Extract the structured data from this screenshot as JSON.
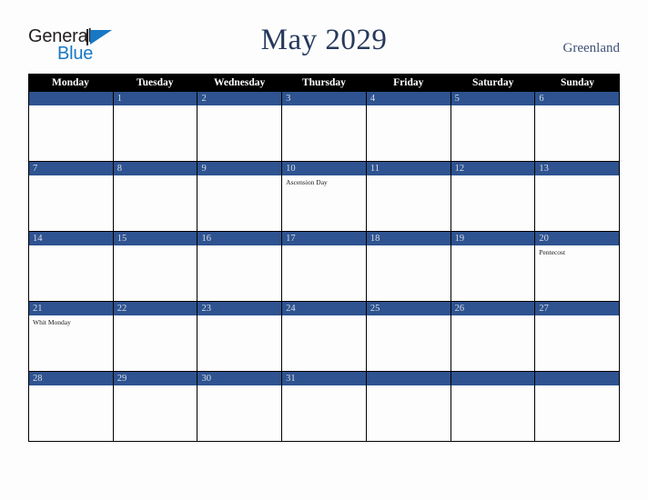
{
  "brand": {
    "line1": "General",
    "line2": "Blue",
    "triangle_color": "#1878c4"
  },
  "header": {
    "title": "May 2029",
    "country": "Greenland",
    "title_color": "#26395c"
  },
  "calendar": {
    "accent_color": "#2e5390",
    "header_bg": "#000000",
    "weekdays": [
      "Monday",
      "Tuesday",
      "Wednesday",
      "Thursday",
      "Friday",
      "Saturday",
      "Sunday"
    ],
    "weeks": [
      [
        {
          "date": "",
          "event": ""
        },
        {
          "date": "1",
          "event": ""
        },
        {
          "date": "2",
          "event": ""
        },
        {
          "date": "3",
          "event": ""
        },
        {
          "date": "4",
          "event": ""
        },
        {
          "date": "5",
          "event": ""
        },
        {
          "date": "6",
          "event": ""
        }
      ],
      [
        {
          "date": "7",
          "event": ""
        },
        {
          "date": "8",
          "event": ""
        },
        {
          "date": "9",
          "event": ""
        },
        {
          "date": "10",
          "event": "Ascension Day"
        },
        {
          "date": "11",
          "event": ""
        },
        {
          "date": "12",
          "event": ""
        },
        {
          "date": "13",
          "event": ""
        }
      ],
      [
        {
          "date": "14",
          "event": ""
        },
        {
          "date": "15",
          "event": ""
        },
        {
          "date": "16",
          "event": ""
        },
        {
          "date": "17",
          "event": ""
        },
        {
          "date": "18",
          "event": ""
        },
        {
          "date": "19",
          "event": ""
        },
        {
          "date": "20",
          "event": "Pentecost"
        }
      ],
      [
        {
          "date": "21",
          "event": "Whit Monday"
        },
        {
          "date": "22",
          "event": ""
        },
        {
          "date": "23",
          "event": ""
        },
        {
          "date": "24",
          "event": ""
        },
        {
          "date": "25",
          "event": ""
        },
        {
          "date": "26",
          "event": ""
        },
        {
          "date": "27",
          "event": ""
        }
      ],
      [
        {
          "date": "28",
          "event": ""
        },
        {
          "date": "29",
          "event": ""
        },
        {
          "date": "30",
          "event": ""
        },
        {
          "date": "31",
          "event": ""
        },
        {
          "date": "",
          "event": ""
        },
        {
          "date": "",
          "event": ""
        },
        {
          "date": "",
          "event": ""
        }
      ]
    ]
  }
}
